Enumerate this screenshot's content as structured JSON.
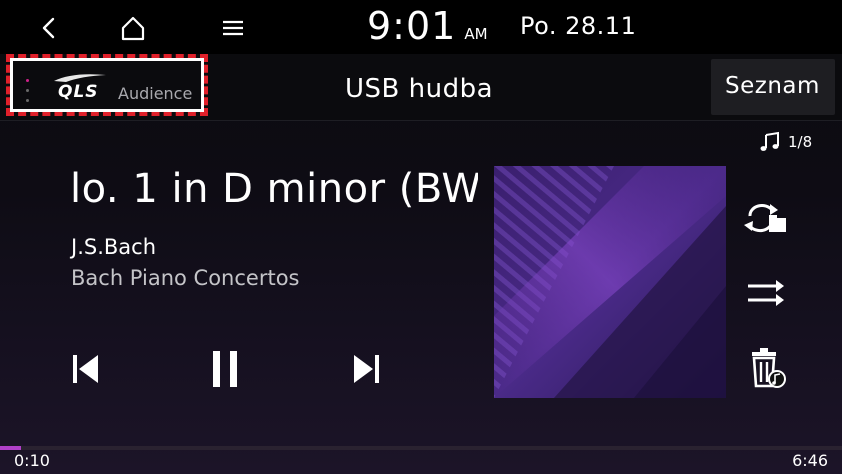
{
  "status_bar": {
    "time": "9:01",
    "ampm": "AM",
    "date": "Po. 28.11",
    "back_icon": "chevron-left-icon",
    "home_icon": "home-icon",
    "menu_icon": "hamburger-menu-icon"
  },
  "header": {
    "logo_brand": "QLS",
    "logo_sub": "Audience",
    "source_title": "USB hudba",
    "list_button_label": "Seznam"
  },
  "track": {
    "counter": "1/8",
    "counter_icon": "music-note-icon",
    "title": "lo. 1 in D minor (BW",
    "artist": "J.S.Bach",
    "album": "Bach Piano Concertos"
  },
  "controls": {
    "prev_icon": "skip-previous-icon",
    "pause_icon": "pause-icon",
    "next_icon": "skip-next-icon"
  },
  "side_actions": {
    "repeat_icon": "repeat-folder-icon",
    "shuffle_icon": "shuffle-icon",
    "delete_icon": "delete-music-icon"
  },
  "progress": {
    "elapsed": "0:10",
    "total": "6:46",
    "fraction": 0.0246
  },
  "colors": {
    "background": "#000000",
    "progress_accent": "#b040c8",
    "highlight_border": "#e0202a",
    "album_art_primary": "#5a2a8c"
  }
}
